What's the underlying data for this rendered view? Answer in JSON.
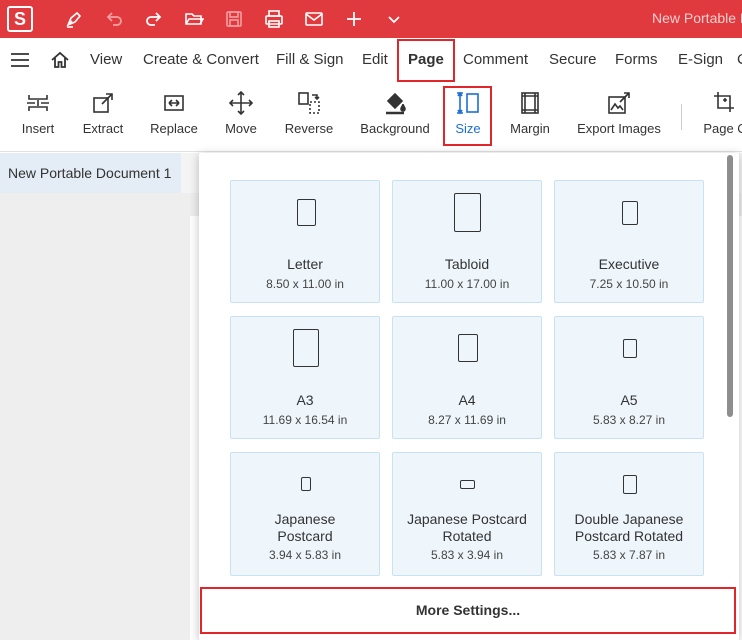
{
  "titlebar": {
    "logo": "S",
    "doc_title": "New Portable D",
    "quick_access": [
      "pen-icon",
      "undo-icon",
      "redo-icon",
      "open-folder-icon",
      "save-icon",
      "print-icon",
      "mail-icon",
      "plus-icon",
      "chevron-down-icon"
    ]
  },
  "menu": {
    "items": [
      "View",
      "Create & Convert",
      "Fill & Sign",
      "Edit",
      "Page",
      "Comment",
      "Secure",
      "Forms",
      "E-Sign",
      "C"
    ],
    "active": "Page"
  },
  "ribbon": {
    "buttons": [
      "Insert",
      "Extract",
      "Replace",
      "Move",
      "Reverse",
      "Background",
      "Size",
      "Margin",
      "Export Images",
      "Page C"
    ],
    "active": "Size"
  },
  "document": {
    "tab_label": "New Portable Document 1"
  },
  "size_menu": {
    "cards": [
      {
        "name": "Letter",
        "dims": "8.50 x 11.00 in"
      },
      {
        "name": "Tabloid",
        "dims": "11.00 x 17.00 in"
      },
      {
        "name": "Executive",
        "dims": "7.25 x 10.50 in"
      },
      {
        "name": "A3",
        "dims": "11.69 x 16.54 in"
      },
      {
        "name": "A4",
        "dims": "8.27 x 11.69 in"
      },
      {
        "name": "A5",
        "dims": "5.83 x 8.27 in"
      },
      {
        "name": "Japanese\nPostcard",
        "dims": "3.94 x 5.83 in"
      },
      {
        "name": "Japanese Postcard\nRotated",
        "dims": "5.83 x 3.94 in"
      },
      {
        "name": "Double Japanese\nPostcard Rotated",
        "dims": "5.83 x 7.87 in"
      }
    ],
    "more_settings": "More Settings..."
  },
  "colors": {
    "brand_red": "#e0393e",
    "highlight_red": "#e0262b",
    "active_blue": "#1a6fd6",
    "card_bg": "#eef6fc"
  }
}
